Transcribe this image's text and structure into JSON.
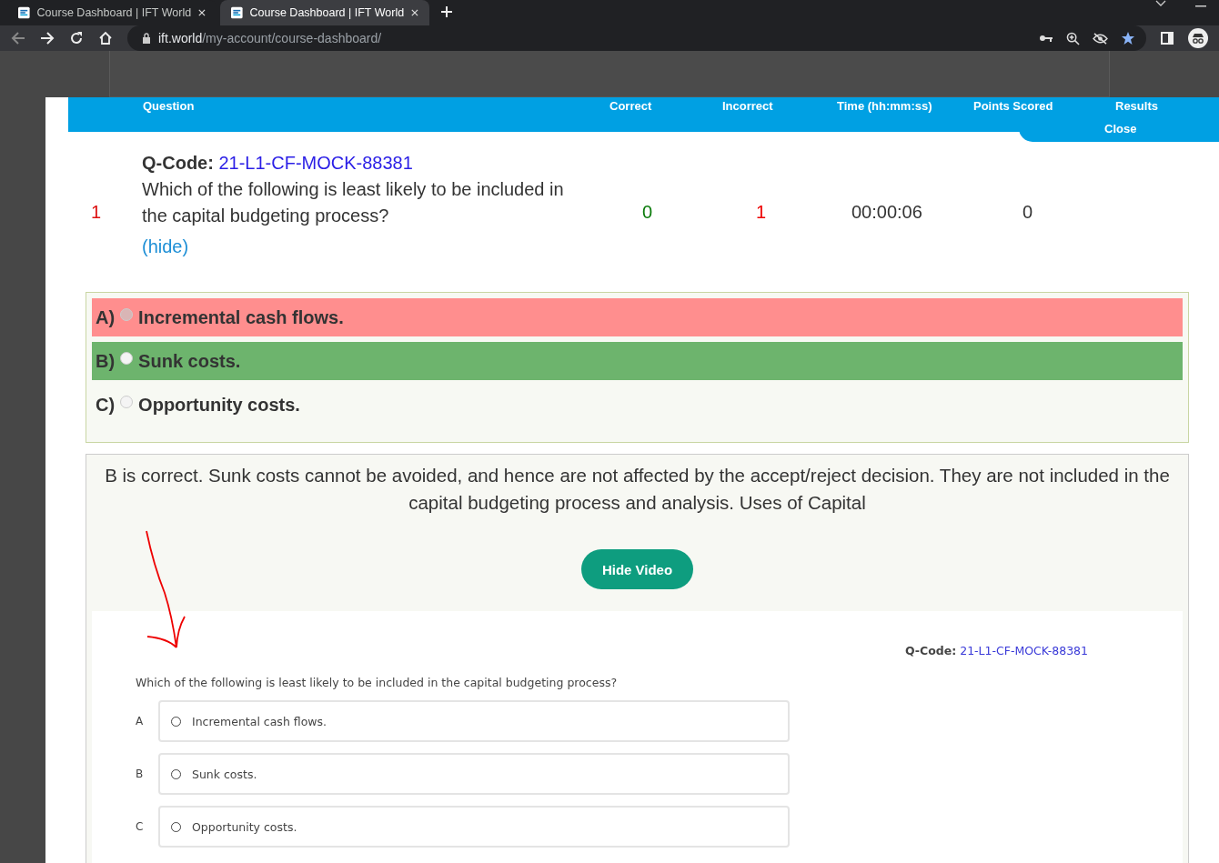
{
  "browser": {
    "tabs": [
      {
        "title": "Course Dashboard | IFT World",
        "selected": false
      },
      {
        "title": "Course Dashboard | IFT World",
        "selected": true
      }
    ],
    "url_domain": "ift.world",
    "url_path": "/my-account/course-dashboard/"
  },
  "results_table": {
    "columns": [
      "Question",
      "Correct",
      "Incorrect",
      "Time (hh:mm:ss)",
      "Points Scored",
      "Results"
    ],
    "close_label": "Close",
    "row": {
      "number": "1",
      "qcode_label": "Q-Code:",
      "qcode": "21-L1-CF-MOCK-88381",
      "question": "Which of the following is least likely to be included in the capital budgeting process?",
      "toggle": "(hide)",
      "correct": "0",
      "incorrect": "1",
      "time": "00:00:06",
      "points": "0"
    }
  },
  "options": [
    {
      "letter": "A)",
      "text": "Incremental cash flows.",
      "selected": true,
      "is_correct": false
    },
    {
      "letter": "B)",
      "text": "Sunk costs.",
      "selected": false,
      "is_correct": true
    },
    {
      "letter": "C)",
      "text": "Opportunity costs.",
      "selected": false,
      "is_correct": false
    }
  ],
  "explanation": "B is correct. Sunk costs cannot be avoided, and hence are not affected by the accept/reject decision. They are not included in the capital budgeting process and analysis. Uses of Capital",
  "video_button": "Hide Video",
  "video": {
    "qcode_label": "Q-Code:",
    "qcode": "21-L1-CF-MOCK-88381",
    "question": "Which of the following is least likely to be included in the capital budgeting process?",
    "options": [
      {
        "letter": "A",
        "text": "Incremental cash flows.",
        "checked": false
      },
      {
        "letter": "B",
        "text": "Sunk costs.",
        "checked": false
      },
      {
        "letter": "C",
        "text": "Opportunity costs.",
        "checked": false
      }
    ]
  }
}
